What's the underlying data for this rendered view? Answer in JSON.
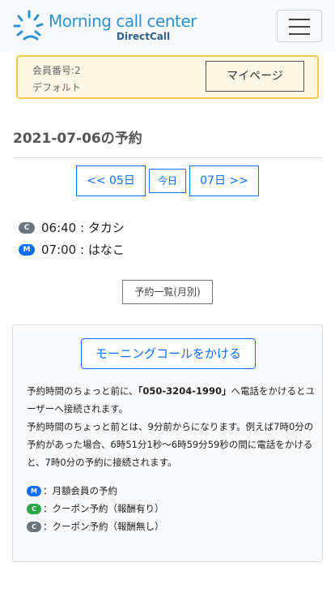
{
  "header": {
    "brand_title": "Morning call center",
    "brand_sub": "DirectCall",
    "menu_icon": "hamburger-icon"
  },
  "member": {
    "number": "会員番号:2",
    "plan": "デフォルト",
    "mypage_label": "マイページ"
  },
  "day": {
    "title": "2021-07-06の予約",
    "prev_label": "<< 05日",
    "today_label": "今日",
    "next_label": "07日 >>"
  },
  "reservations": [
    {
      "badge": "C",
      "text": "06:40 : タカシ"
    },
    {
      "badge": "M",
      "text": "07:00 : はなこ"
    }
  ],
  "list_button": "予約一覧(月別)",
  "info": {
    "call_button": "モーニングコールをかける",
    "text_before": "予約時間のちょっと前に、",
    "phone": "「050-3204-1990」",
    "text_after": "へ電話をかけるとユーザーへ接続されます。",
    "text2": "予約時間のちょっと前とは、9分前からになります。例えば7時0分の予約があった場合、6時51分1秒〜6時59分59秒の間に電話をかけると、7時0分の予約に接続されます。"
  },
  "legend": [
    {
      "badge": "M",
      "text": "：月額会員の予約"
    },
    {
      "badge": "C",
      "text": "：クーポン予約（報酬有り）"
    },
    {
      "badge": "C",
      "text": "：クーポン予約（報酬無し）"
    }
  ],
  "colors": {
    "accent": "#0d6efd",
    "brand": "#2b93d1",
    "badge_gray": "#6c757d",
    "badge_green": "#28a745",
    "member_border": "#f3c94f"
  }
}
